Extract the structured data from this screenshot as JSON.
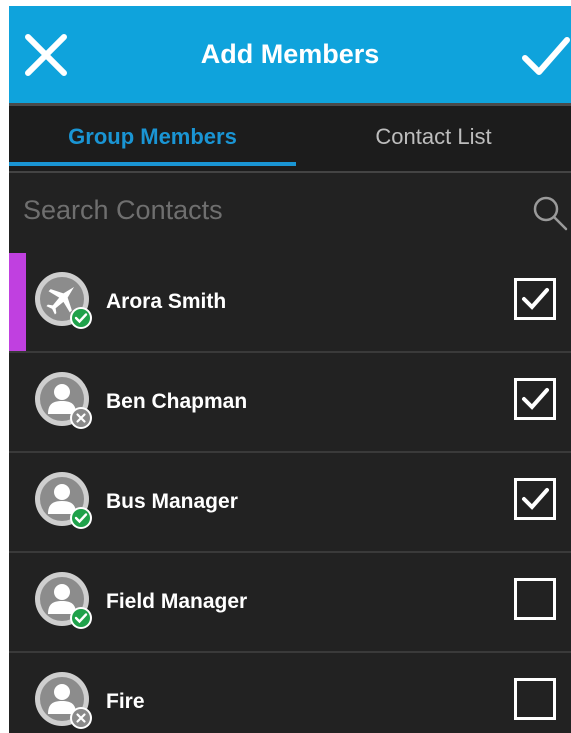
{
  "header": {
    "title": "Add Members",
    "close_icon": "close-icon",
    "confirm_icon": "checkmark-icon",
    "background_color": "#0fa3dc"
  },
  "tabs": [
    {
      "label": "Group Members",
      "active": true
    },
    {
      "label": "Contact List",
      "active": false
    }
  ],
  "search": {
    "placeholder": "Search Contacts",
    "value": "",
    "icon": "search-icon"
  },
  "contacts": [
    {
      "name": "Arora Smith",
      "avatar": "airplane-icon",
      "status": "online",
      "checked": true,
      "highlighted": true
    },
    {
      "name": "Ben Chapman",
      "avatar": "person-icon",
      "status": "offline",
      "checked": true,
      "highlighted": false
    },
    {
      "name": "Bus Manager",
      "avatar": "person-icon",
      "status": "online",
      "checked": true,
      "highlighted": false
    },
    {
      "name": "Field Manager",
      "avatar": "person-icon",
      "status": "online",
      "checked": false,
      "highlighted": false
    },
    {
      "name": "Fire",
      "avatar": "person-icon",
      "status": "offline",
      "checked": false,
      "highlighted": false
    }
  ],
  "colors": {
    "accent": "#1a95d4",
    "highlight_marker": "#c040e0",
    "online": "#1fa14a",
    "offline": "#8a8a8a"
  }
}
